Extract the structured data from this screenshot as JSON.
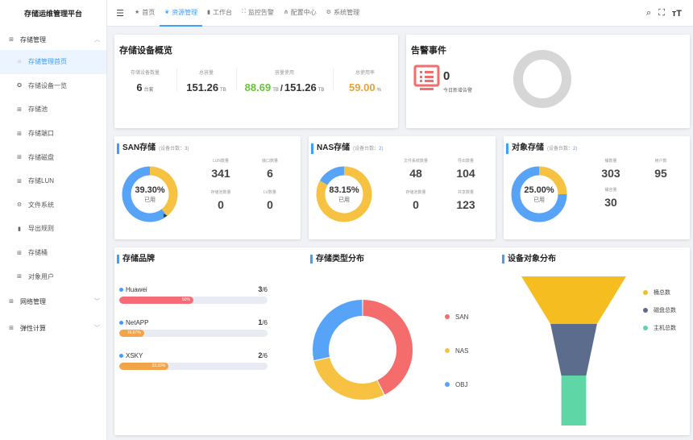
{
  "sidebar": {
    "brand": "存储运维管理平台",
    "groups": [
      {
        "label": "存储管理",
        "icon": "grid-icon"
      },
      {
        "label": "网络管理",
        "icon": "grid-icon"
      },
      {
        "label": "弹性计算",
        "icon": "grid-icon"
      }
    ],
    "items": [
      {
        "label": "存储管理首页",
        "icon": "home-icon"
      },
      {
        "label": "存储设备一览",
        "icon": "device-icon"
      },
      {
        "label": "存储池",
        "icon": "grid-icon"
      },
      {
        "label": "存储端口",
        "icon": "grid-icon"
      },
      {
        "label": "存储磁盘",
        "icon": "grid-icon"
      },
      {
        "label": "存储LUN",
        "icon": "grid-icon"
      },
      {
        "label": "文件系统",
        "icon": "gear-icon"
      },
      {
        "label": "导出规则",
        "icon": "bar-chart-icon"
      },
      {
        "label": "存储桶",
        "icon": "grid-icon"
      },
      {
        "label": "对象用户",
        "icon": "grid-icon"
      }
    ]
  },
  "topnav": [
    {
      "label": "首页",
      "icon": "star-icon"
    },
    {
      "label": "资源管理",
      "icon": "leaf-icon"
    },
    {
      "label": "工作台",
      "icon": "bar-chart-icon"
    },
    {
      "label": "监控告警",
      "icon": "expand-icon"
    },
    {
      "label": "配置中心",
      "icon": "tree-icon"
    },
    {
      "label": "系统管理",
      "icon": "gear-icon"
    }
  ],
  "overview": {
    "title": "存储设备概览",
    "device_count": {
      "label": "存储设备数量",
      "value": "6",
      "unit": "台套"
    },
    "total": {
      "label": "总容量",
      "value": "151.26",
      "unit": "TB"
    },
    "used": {
      "label": "容量使用",
      "value": "88.69",
      "unit": "TB",
      "sep": "/",
      "total": "151.26",
      "total_unit": "TB"
    },
    "usage": {
      "label": "总使用率",
      "value": "59.00",
      "unit": "%"
    }
  },
  "alarm": {
    "title": "告警事件",
    "count": "0",
    "label": "今日新增告警"
  },
  "san": {
    "title": "SAN存储",
    "sub_prefix": "(设备台数：",
    "sub_count": "3",
    "sub_suffix": ")",
    "percent": "39.30%",
    "used_label": "已用",
    "used_fraction": 0.393,
    "stats": [
      {
        "label": "LUN数量",
        "value": "341"
      },
      {
        "label": "接口数量",
        "value": "6"
      },
      {
        "label": "存储池数量",
        "value": "0"
      },
      {
        "label": "LV数量",
        "value": "0"
      }
    ]
  },
  "nas": {
    "title": "NAS存储",
    "sub_prefix": "(设备台数：",
    "sub_count": "2",
    "sub_suffix": ")",
    "percent": "83.15%",
    "used_label": "已用",
    "used_fraction": 0.8315,
    "stats": [
      {
        "label": "文件系统数量",
        "value": "48"
      },
      {
        "label": "导出数量",
        "value": "104"
      },
      {
        "label": "存储池数量",
        "value": "0"
      },
      {
        "label": "共享数量",
        "value": "123"
      }
    ]
  },
  "obj": {
    "title": "对象存储",
    "sub_prefix": "(设备台数：",
    "sub_count": "2",
    "sub_suffix": ")",
    "percent": "25.00%",
    "used_label": "已用",
    "used_fraction": 0.25,
    "stats": [
      {
        "label": "桶数量",
        "value": "303"
      },
      {
        "label": "用户数",
        "value": "95"
      },
      {
        "label": "桶容量",
        "value": "30"
      }
    ]
  },
  "brands": {
    "title": "存储品牌",
    "items": [
      {
        "name": "Huawei",
        "count": "3",
        "total": "/6",
        "fraction": 0.5,
        "pct": "50%",
        "color": "#f56c78"
      },
      {
        "name": "NetAPP",
        "count": "1",
        "total": "/6",
        "fraction": 0.1667,
        "pct": "16.67%",
        "color": "#f4a448"
      },
      {
        "name": "XSKY",
        "count": "2",
        "total": "/6",
        "fraction": 0.3333,
        "pct": "33.33%",
        "color": "#f4a448"
      }
    ]
  },
  "type_dist": {
    "title": "存储类型分布",
    "legend": [
      {
        "label": "SAN",
        "color": "#f56c6c"
      },
      {
        "label": "NAS",
        "color": "#f7c242"
      },
      {
        "label": "OBJ",
        "color": "#56a3f7"
      }
    ]
  },
  "obj_dist": {
    "title": "设备对象分布",
    "legend": [
      {
        "label": "桶总数",
        "color": "#f5bd1f"
      },
      {
        "label": "磁盘总数",
        "color": "#5b6c8c"
      },
      {
        "label": "主机总数",
        "color": "#5fd6a5"
      }
    ]
  },
  "chart_data": [
    {
      "type": "pie",
      "title": "存储类型分布",
      "categories": [
        "SAN",
        "NAS",
        "OBJ"
      ],
      "values": [
        3,
        2,
        2
      ],
      "colors": [
        "#f56c6c",
        "#f7c242",
        "#56a3f7"
      ]
    },
    {
      "type": "funnel",
      "title": "设备对象分布",
      "categories": [
        "桶总数",
        "磁盘总数",
        "主机总数"
      ],
      "values": [
        303,
        104,
        30
      ],
      "colors": [
        "#f5bd1f",
        "#5b6c8c",
        "#5fd6a5"
      ]
    }
  ],
  "colors": {
    "accent": "#409eff",
    "green": "#67c23a",
    "orange": "#e6a23c",
    "alarm_red": "#f56c6c",
    "donut_blue": "#56a3f7",
    "donut_yellow": "#f7c242"
  }
}
